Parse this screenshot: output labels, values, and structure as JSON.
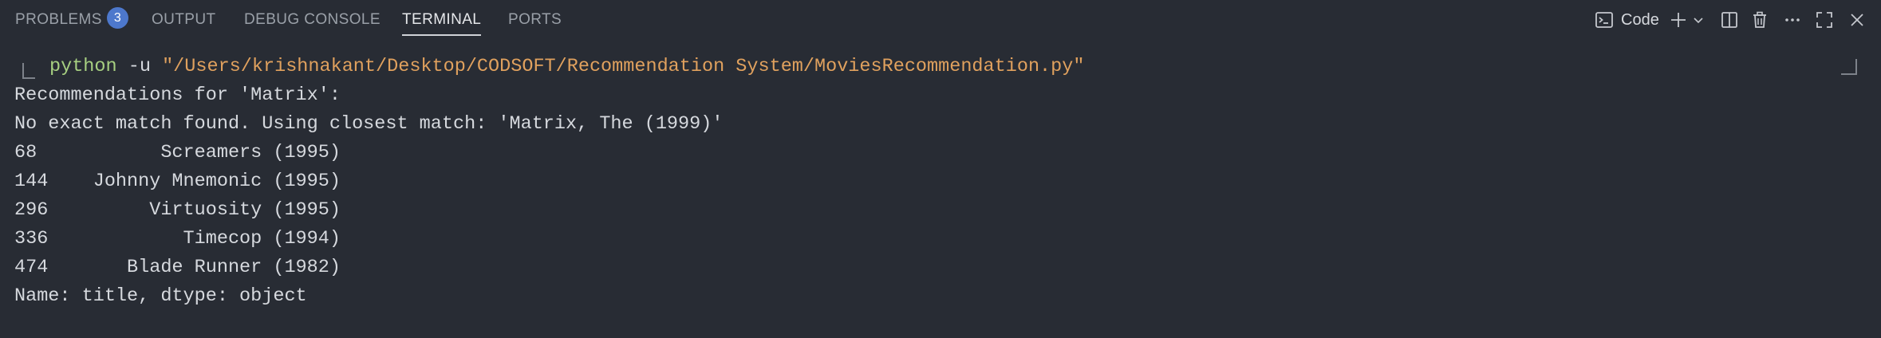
{
  "tabs": [
    {
      "label": "PROBLEMS",
      "badge": "3",
      "active": false
    },
    {
      "label": "OUTPUT",
      "active": false
    },
    {
      "label": "DEBUG CONSOLE",
      "active": false
    },
    {
      "label": "TERMINAL",
      "active": true
    },
    {
      "label": "PORTS",
      "active": false
    }
  ],
  "toolbar": {
    "terminal_name": "Code",
    "icons": [
      "terminal-icon",
      "plus-icon",
      "chevron-down-icon",
      "split-icon",
      "trash-icon",
      "more-icon",
      "maximize-icon",
      "close-icon"
    ]
  },
  "terminal": {
    "command": {
      "program": "python",
      "flag": "-u",
      "path": "\"/Users/krishnakant/Desktop/CODSOFT/Recommendation System/MoviesRecommendation.py\""
    },
    "output_lines": [
      "Recommendations for 'Matrix':",
      "No exact match found. Using closest match: 'Matrix, The (1999)'",
      "68           Screamers (1995)",
      "144    Johnny Mnemonic (1995)",
      "296         Virtuosity (1995)",
      "336            Timecop (1994)",
      "474       Blade Runner (1982)",
      "Name: title, dtype: object"
    ]
  },
  "colors": {
    "background": "#282c34",
    "badge": "#4d78cc",
    "command_program": "#a7d081",
    "command_path": "#e0a15e"
  }
}
